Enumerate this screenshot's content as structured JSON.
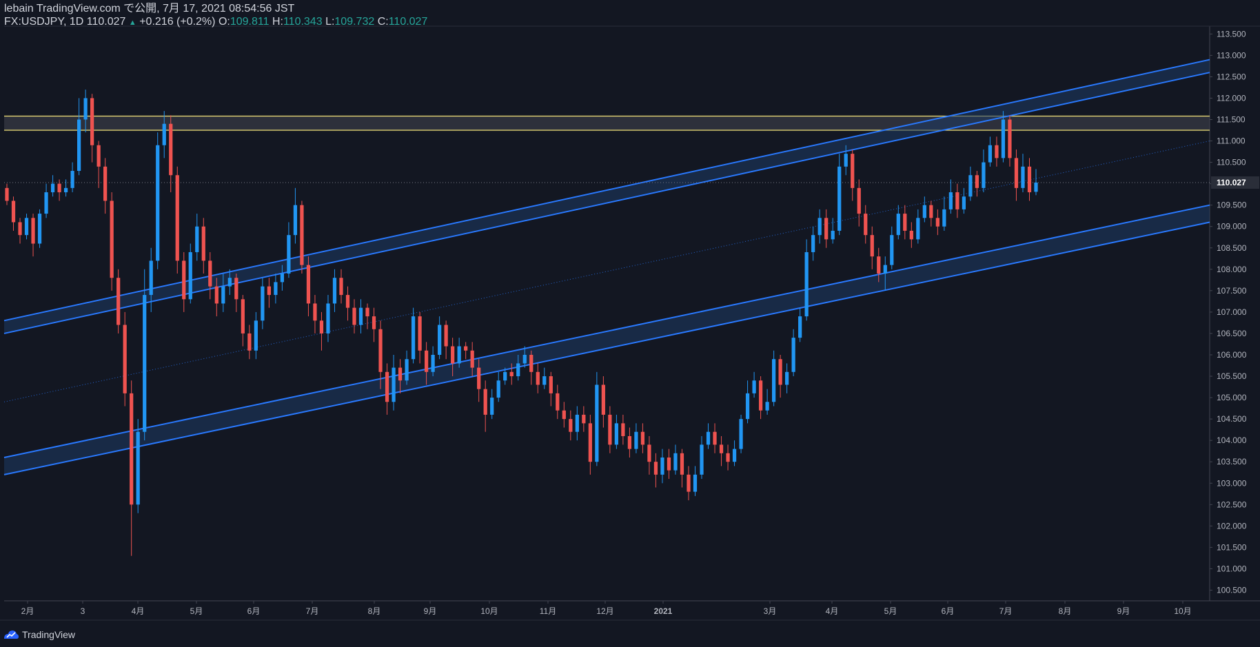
{
  "header": {
    "publish_line": "lebain TradingView.com で公開, 7月 17, 2021 08:54:56 JST",
    "symbol": "FX:USDJPY, 1D",
    "last": "110.027",
    "change_icon": "triangle-up-icon",
    "change": "+0.216 (+0.2%)",
    "o_label": "O:",
    "o_value": "109.811",
    "h_label": "H:",
    "h_value": "110.343",
    "l_label": "L:",
    "l_value": "109.732",
    "c_label": "C:",
    "c_value": "110.027"
  },
  "footer": {
    "brand": "TradingView",
    "logo_icon": "tradingview-logo-icon"
  },
  "colors": {
    "background": "#131722",
    "up": "#2196f3",
    "down": "#ef5350",
    "channel": "#2979ff",
    "channel_fill": "#1e3a64",
    "resistance": "#f2e27a",
    "resistance_fill": "#434651",
    "axis_text": "#b2b5be",
    "price_label_bg": "#2a2e39"
  },
  "chart_data": {
    "type": "candlestick",
    "symbol": "FX:USDJPY",
    "interval": "1D",
    "ylim": [
      100.25,
      113.65
    ],
    "y_ticks": [
      "113.500",
      "113.000",
      "112.500",
      "112.000",
      "111.500",
      "111.000",
      "110.500",
      "110.000",
      "109.500",
      "109.000",
      "108.500",
      "108.000",
      "107.500",
      "107.000",
      "106.500",
      "106.000",
      "105.500",
      "105.000",
      "104.500",
      "104.000",
      "103.500",
      "103.000",
      "102.500",
      "102.000",
      "101.500",
      "101.000",
      "100.500"
    ],
    "x_ticks": [
      "2月",
      "3",
      "4月",
      "5月",
      "6月",
      "7月",
      "8月",
      "9月",
      "10月",
      "11月",
      "12月",
      "2021",
      "3月",
      "4月",
      "5月",
      "6月",
      "7月",
      "8月",
      "9月",
      "10月"
    ],
    "last_price_label": "110.027",
    "candles": [
      [
        109.9,
        109.6,
        110.0,
        109.5
      ],
      [
        109.6,
        109.1,
        109.7,
        108.9
      ],
      [
        109.1,
        108.8,
        109.2,
        108.6
      ],
      [
        108.8,
        109.2,
        109.3,
        108.7
      ],
      [
        109.2,
        108.6,
        109.3,
        108.3
      ],
      [
        108.6,
        109.3,
        109.4,
        108.5
      ],
      [
        109.3,
        109.8,
        110.0,
        109.2
      ],
      [
        109.8,
        110.0,
        110.2,
        109.7
      ],
      [
        110.0,
        109.8,
        110.1,
        109.6
      ],
      [
        109.8,
        109.9,
        110.1,
        109.7
      ],
      [
        109.9,
        110.3,
        110.5,
        109.8
      ],
      [
        110.3,
        111.5,
        112.0,
        110.2
      ],
      [
        111.5,
        112.0,
        112.2,
        111.2
      ],
      [
        112.0,
        110.9,
        112.1,
        110.5
      ],
      [
        110.9,
        110.4,
        111.0,
        109.9
      ],
      [
        110.4,
        109.6,
        110.6,
        109.3
      ],
      [
        109.6,
        107.8,
        109.8,
        107.5
      ],
      [
        107.8,
        106.7,
        108.0,
        106.5
      ],
      [
        106.7,
        105.1,
        107.0,
        104.8
      ],
      [
        105.1,
        102.5,
        105.4,
        101.3
      ],
      [
        102.5,
        104.2,
        104.5,
        102.3
      ],
      [
        104.2,
        107.4,
        108.0,
        104.0
      ],
      [
        107.4,
        108.2,
        108.5,
        107.0
      ],
      [
        108.2,
        110.9,
        111.2,
        108.0
      ],
      [
        110.9,
        111.4,
        111.7,
        110.6
      ],
      [
        111.4,
        110.2,
        111.6,
        109.8
      ],
      [
        110.2,
        108.2,
        110.4,
        107.9
      ],
      [
        108.2,
        107.3,
        108.4,
        107.0
      ],
      [
        107.3,
        108.4,
        108.6,
        107.2
      ],
      [
        108.4,
        109.0,
        109.3,
        108.2
      ],
      [
        109.0,
        108.2,
        109.2,
        107.9
      ],
      [
        108.2,
        107.6,
        108.4,
        107.3
      ],
      [
        107.6,
        107.2,
        107.8,
        106.9
      ],
      [
        107.2,
        107.6,
        107.9,
        107.0
      ],
      [
        107.6,
        107.8,
        108.0,
        107.4
      ],
      [
        107.8,
        107.3,
        107.9,
        107.0
      ],
      [
        107.3,
        106.5,
        107.4,
        106.2
      ],
      [
        106.5,
        106.1,
        106.7,
        105.9
      ],
      [
        106.1,
        106.8,
        107.0,
        105.9
      ],
      [
        106.8,
        107.6,
        107.8,
        106.6
      ],
      [
        107.6,
        107.4,
        107.8,
        107.1
      ],
      [
        107.4,
        107.7,
        107.9,
        107.2
      ],
      [
        107.7,
        107.9,
        108.1,
        107.5
      ],
      [
        107.9,
        108.8,
        109.1,
        107.8
      ],
      [
        108.8,
        109.5,
        109.9,
        108.6
      ],
      [
        109.5,
        108.1,
        109.6,
        107.9
      ],
      [
        108.1,
        107.2,
        108.3,
        106.9
      ],
      [
        107.2,
        106.8,
        107.4,
        106.5
      ],
      [
        106.8,
        106.5,
        107.0,
        106.1
      ],
      [
        106.5,
        107.2,
        107.4,
        106.3
      ],
      [
        107.2,
        107.8,
        108.0,
        107.0
      ],
      [
        107.8,
        107.4,
        108.0,
        107.2
      ],
      [
        107.4,
        107.1,
        107.6,
        106.8
      ],
      [
        107.1,
        106.7,
        107.3,
        106.5
      ],
      [
        106.7,
        107.1,
        107.3,
        106.5
      ],
      [
        107.1,
        106.9,
        107.2,
        106.6
      ],
      [
        106.9,
        106.6,
        107.1,
        106.3
      ],
      [
        106.6,
        105.6,
        106.8,
        105.2
      ],
      [
        105.6,
        104.9,
        105.8,
        104.6
      ],
      [
        104.9,
        105.7,
        106.0,
        104.7
      ],
      [
        105.7,
        105.4,
        105.9,
        105.1
      ],
      [
        105.4,
        105.9,
        106.1,
        105.3
      ],
      [
        105.9,
        106.9,
        107.1,
        105.8
      ],
      [
        106.9,
        106.1,
        107.0,
        105.8
      ],
      [
        106.1,
        105.6,
        106.3,
        105.3
      ],
      [
        105.6,
        106.0,
        106.2,
        105.5
      ],
      [
        106.0,
        106.7,
        106.9,
        105.9
      ],
      [
        106.7,
        106.2,
        106.8,
        105.9
      ],
      [
        106.2,
        105.8,
        106.4,
        105.5
      ],
      [
        105.8,
        106.2,
        106.4,
        105.7
      ],
      [
        106.2,
        106.1,
        106.3,
        105.9
      ],
      [
        106.1,
        105.7,
        106.3,
        105.5
      ],
      [
        105.7,
        105.2,
        105.9,
        104.9
      ],
      [
        105.2,
        104.6,
        105.4,
        104.2
      ],
      [
        104.6,
        105.0,
        105.2,
        104.5
      ],
      [
        105.0,
        105.4,
        105.6,
        104.9
      ],
      [
        105.4,
        105.6,
        105.7,
        105.3
      ],
      [
        105.6,
        105.5,
        105.8,
        105.3
      ],
      [
        105.5,
        105.8,
        106.0,
        105.4
      ],
      [
        105.8,
        106.0,
        106.2,
        105.7
      ],
      [
        106.0,
        105.6,
        106.1,
        105.3
      ],
      [
        105.6,
        105.3,
        105.8,
        105.1
      ],
      [
        105.3,
        105.5,
        105.7,
        105.2
      ],
      [
        105.5,
        105.1,
        105.6,
        104.8
      ],
      [
        105.1,
        104.7,
        105.3,
        104.5
      ],
      [
        104.7,
        104.5,
        104.9,
        104.3
      ],
      [
        104.5,
        104.2,
        104.7,
        104.0
      ],
      [
        104.2,
        104.6,
        104.8,
        104.0
      ],
      [
        104.6,
        104.4,
        104.8,
        104.2
      ],
      [
        104.4,
        103.5,
        104.6,
        103.2
      ],
      [
        103.5,
        105.3,
        105.6,
        103.4
      ],
      [
        105.3,
        104.6,
        105.5,
        104.3
      ],
      [
        104.6,
        103.9,
        104.8,
        103.7
      ],
      [
        103.9,
        104.4,
        104.6,
        103.8
      ],
      [
        104.4,
        104.1,
        104.6,
        103.9
      ],
      [
        104.1,
        103.8,
        104.3,
        103.6
      ],
      [
        103.8,
        104.2,
        104.4,
        103.7
      ],
      [
        104.2,
        103.9,
        104.4,
        103.7
      ],
      [
        103.9,
        103.5,
        104.1,
        103.2
      ],
      [
        103.5,
        103.2,
        103.7,
        102.9
      ],
      [
        103.2,
        103.6,
        103.8,
        103.0
      ],
      [
        103.6,
        103.3,
        103.8,
        103.1
      ],
      [
        103.3,
        103.7,
        103.9,
        103.2
      ],
      [
        103.7,
        103.2,
        103.8,
        102.9
      ],
      [
        103.2,
        102.8,
        103.4,
        102.6
      ],
      [
        102.8,
        103.2,
        103.4,
        102.7
      ],
      [
        103.2,
        103.9,
        104.1,
        103.1
      ],
      [
        103.9,
        104.2,
        104.4,
        103.8
      ],
      [
        104.2,
        103.9,
        104.4,
        103.7
      ],
      [
        103.9,
        103.7,
        104.1,
        103.4
      ],
      [
        103.7,
        103.5,
        103.9,
        103.3
      ],
      [
        103.5,
        103.8,
        104.0,
        103.4
      ],
      [
        103.8,
        104.5,
        104.6,
        103.7
      ],
      [
        104.5,
        105.1,
        105.4,
        104.4
      ],
      [
        105.1,
        105.4,
        105.6,
        105.0
      ],
      [
        105.4,
        104.7,
        105.5,
        104.5
      ],
      [
        104.7,
        104.9,
        105.2,
        104.6
      ],
      [
        104.9,
        105.9,
        106.1,
        104.8
      ],
      [
        105.9,
        105.3,
        106.0,
        105.0
      ],
      [
        105.3,
        105.6,
        105.8,
        105.1
      ],
      [
        105.6,
        106.4,
        106.6,
        105.5
      ],
      [
        106.4,
        106.9,
        107.1,
        106.3
      ],
      [
        106.9,
        108.4,
        108.7,
        106.8
      ],
      [
        108.4,
        108.8,
        109.0,
        108.2
      ],
      [
        108.8,
        109.2,
        109.4,
        108.6
      ],
      [
        109.2,
        108.7,
        109.4,
        108.5
      ],
      [
        108.7,
        108.9,
        109.2,
        108.6
      ],
      [
        108.9,
        110.4,
        110.7,
        108.8
      ],
      [
        110.4,
        110.7,
        110.9,
        110.2
      ],
      [
        110.7,
        109.9,
        110.8,
        109.6
      ],
      [
        109.9,
        109.3,
        110.1,
        109.0
      ],
      [
        109.3,
        108.8,
        109.5,
        108.6
      ],
      [
        108.8,
        108.3,
        109.0,
        108.0
      ],
      [
        108.3,
        107.9,
        108.5,
        107.7
      ],
      [
        107.9,
        108.1,
        108.3,
        107.5
      ],
      [
        108.1,
        108.8,
        109.0,
        108.0
      ],
      [
        108.8,
        109.3,
        109.5,
        108.7
      ],
      [
        109.3,
        108.9,
        109.5,
        108.7
      ],
      [
        108.9,
        108.7,
        109.1,
        108.5
      ],
      [
        108.7,
        109.2,
        109.4,
        108.6
      ],
      [
        109.2,
        109.5,
        109.7,
        109.1
      ],
      [
        109.5,
        109.2,
        109.6,
        109.0
      ],
      [
        109.2,
        109.0,
        109.4,
        108.8
      ],
      [
        109.0,
        109.4,
        109.7,
        108.9
      ],
      [
        109.4,
        109.8,
        110.1,
        109.3
      ],
      [
        109.8,
        109.4,
        110.0,
        109.2
      ],
      [
        109.4,
        109.7,
        109.9,
        109.3
      ],
      [
        109.7,
        110.2,
        110.4,
        109.6
      ],
      [
        110.2,
        109.9,
        110.3,
        109.7
      ],
      [
        109.9,
        110.5,
        110.8,
        109.8
      ],
      [
        110.5,
        110.9,
        111.1,
        110.4
      ],
      [
        110.9,
        110.6,
        111.1,
        110.4
      ],
      [
        110.6,
        111.5,
        111.7,
        110.5
      ],
      [
        111.5,
        110.6,
        111.6,
        110.4
      ],
      [
        110.6,
        109.9,
        110.8,
        109.6
      ],
      [
        109.9,
        110.4,
        110.7,
        109.8
      ],
      [
        110.4,
        109.8,
        110.6,
        109.6
      ],
      [
        109.811,
        110.027,
        110.343,
        109.732
      ]
    ],
    "channel_upper": {
      "line_a": [
        [
          0,
          106.8
        ],
        [
          1,
          112.9
        ]
      ],
      "line_b": [
        [
          0,
          106.5
        ],
        [
          1,
          112.6
        ]
      ]
    },
    "channel_lower": {
      "line_a": [
        [
          0,
          103.6
        ],
        [
          1,
          109.5
        ]
      ],
      "line_b": [
        [
          0,
          103.2
        ],
        [
          1,
          109.1
        ]
      ]
    },
    "midline_dotted": [
      [
        0,
        104.9
      ],
      [
        1,
        111.0
      ]
    ],
    "resistance_zone": [
      111.25,
      111.58
    ]
  }
}
